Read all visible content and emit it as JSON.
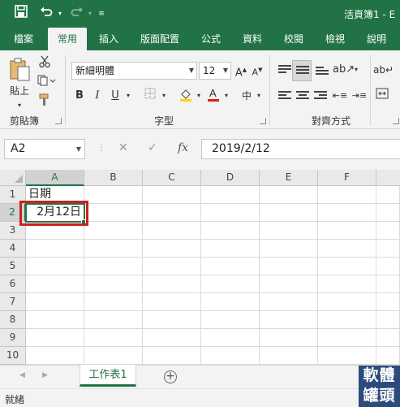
{
  "title_bar": {
    "title": "活頁簿1 - E"
  },
  "qat": {
    "save_icon": "save-icon",
    "undo_icon": "undo-icon",
    "redo_icon": "redo-icon",
    "customize_icon": "customize-qat-icon"
  },
  "tabs": [
    "檔案",
    "常用",
    "插入",
    "版面配置",
    "公式",
    "資料",
    "校閱",
    "檢視",
    "說明"
  ],
  "active_tab": "常用",
  "ribbon": {
    "clipboard": {
      "paste_label": "貼上",
      "group_label": "剪貼簿"
    },
    "font": {
      "font_name": "新細明體",
      "font_size": "12",
      "group_label": "字型"
    },
    "alignment": {
      "group_label": "對齊方式"
    }
  },
  "formula_bar": {
    "name_box": "A2",
    "formula": "2019/2/12"
  },
  "grid": {
    "columns": [
      "A",
      "B",
      "C",
      "D",
      "E",
      "F"
    ],
    "rows": [
      "1",
      "2",
      "3",
      "4",
      "5",
      "6",
      "7",
      "8",
      "9",
      "10"
    ],
    "cells": {
      "A1": "日期",
      "A2": "2月12日"
    },
    "selected_cell": "A2"
  },
  "sheets": [
    "工作表1"
  ],
  "status": {
    "text": "就緒"
  },
  "watermark": {
    "line1": "軟體",
    "line2": "罐頭"
  },
  "colors": {
    "accent": "#217346",
    "highlight": "#cc1f1f"
  }
}
